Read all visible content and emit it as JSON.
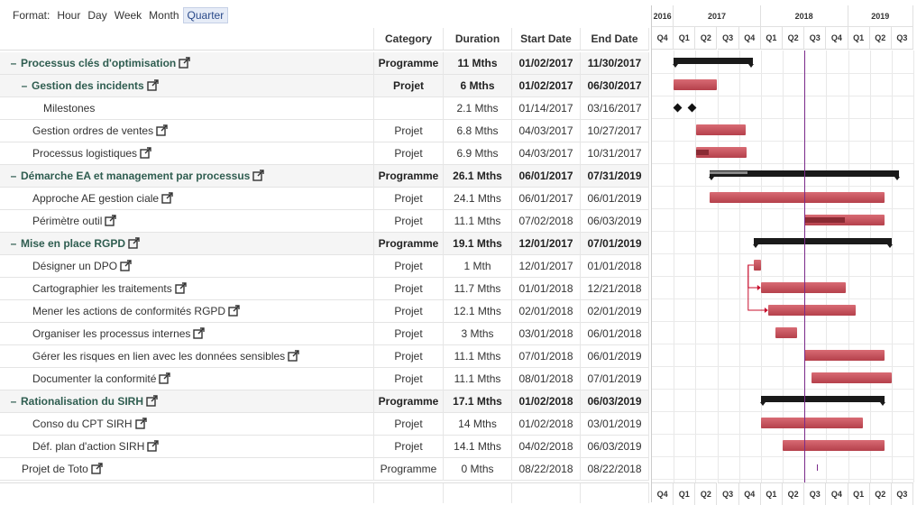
{
  "format_bar": {
    "label": "Format:",
    "options": [
      "Hour",
      "Day",
      "Week",
      "Month",
      "Quarter"
    ],
    "active": "Quarter"
  },
  "columns": {
    "category": "Category",
    "duration": "Duration",
    "start": "Start Date",
    "end": "End Date"
  },
  "rows": [
    {
      "name": "Processus clés d'optimisation",
      "level": 0,
      "group": true,
      "expand": "–",
      "category": "Programme",
      "duration": "11 Mths",
      "start": "01/02/2017",
      "end": "11/30/2017",
      "link": true
    },
    {
      "name": "Gestion des incidents",
      "level": 1,
      "group": true,
      "expand": "–",
      "category": "Projet",
      "duration": "6 Mths",
      "start": "01/02/2017",
      "end": "06/30/2017",
      "link": true
    },
    {
      "name": "Milestones",
      "level": 2,
      "group": false,
      "category": "",
      "duration": "2.1 Mths",
      "start": "01/14/2017",
      "end": "03/16/2017",
      "link": false
    },
    {
      "name": "Gestion ordres de ventes",
      "level": 2,
      "group": false,
      "category": "Projet",
      "duration": "6.8 Mths",
      "start": "04/03/2017",
      "end": "10/27/2017",
      "link": true
    },
    {
      "name": "Processus logistiques",
      "level": 2,
      "group": false,
      "category": "Projet",
      "duration": "6.9 Mths",
      "start": "04/03/2017",
      "end": "10/31/2017",
      "link": true
    },
    {
      "name": "Démarche EA et management par processus",
      "level": 0,
      "group": true,
      "expand": "–",
      "category": "Programme",
      "duration": "26.1 Mths",
      "start": "06/01/2017",
      "end": "07/31/2019",
      "link": true
    },
    {
      "name": "Approche AE gestion ciale",
      "level": 1,
      "group": false,
      "category": "Projet",
      "duration": "24.1 Mths",
      "start": "06/01/2017",
      "end": "06/01/2019",
      "link": true
    },
    {
      "name": "Périmètre outil",
      "level": 1,
      "group": false,
      "category": "Projet",
      "duration": "11.1 Mths",
      "start": "07/02/2018",
      "end": "06/03/2019",
      "link": true
    },
    {
      "name": "Mise en place RGPD",
      "level": 0,
      "group": true,
      "expand": "–",
      "category": "Programme",
      "duration": "19.1 Mths",
      "start": "12/01/2017",
      "end": "07/01/2019",
      "link": true
    },
    {
      "name": "Désigner un DPO",
      "level": 1,
      "group": false,
      "category": "Projet",
      "duration": "1 Mth",
      "start": "12/01/2017",
      "end": "01/01/2018",
      "link": true
    },
    {
      "name": "Cartographier les traitements",
      "level": 1,
      "group": false,
      "category": "Projet",
      "duration": "11.7 Mths",
      "start": "01/01/2018",
      "end": "12/21/2018",
      "link": true
    },
    {
      "name": "Mener les actions de conformités RGPD",
      "level": 1,
      "group": false,
      "category": "Projet",
      "duration": "12.1 Mths",
      "start": "02/01/2018",
      "end": "02/01/2019",
      "link": true
    },
    {
      "name": "Organiser les processus internes",
      "level": 1,
      "group": false,
      "category": "Projet",
      "duration": "3 Mths",
      "start": "03/01/2018",
      "end": "06/01/2018",
      "link": true
    },
    {
      "name": "Gérer les risques en lien avec les données sensibles",
      "level": 1,
      "group": false,
      "category": "Projet",
      "duration": "11.1 Mths",
      "start": "07/01/2018",
      "end": "06/01/2019",
      "link": true
    },
    {
      "name": "Documenter la conformité",
      "level": 1,
      "group": false,
      "category": "Projet",
      "duration": "11.1 Mths",
      "start": "08/01/2018",
      "end": "07/01/2019",
      "link": true
    },
    {
      "name": "Rationalisation du SIRH",
      "level": 0,
      "group": true,
      "expand": "–",
      "category": "Programme",
      "duration": "17.1 Mths",
      "start": "01/02/2018",
      "end": "06/03/2019",
      "link": true
    },
    {
      "name": "Conso du CPT SIRH",
      "level": 1,
      "group": false,
      "category": "Projet",
      "duration": "14 Mths",
      "start": "01/02/2018",
      "end": "03/01/2019",
      "link": true
    },
    {
      "name": "Déf. plan d'action SIRH",
      "level": 1,
      "group": false,
      "category": "Projet",
      "duration": "14.1 Mths",
      "start": "04/02/2018",
      "end": "06/03/2019",
      "link": true
    },
    {
      "name": "Projet de Toto",
      "level": 0,
      "group": false,
      "category": "Programme",
      "duration": "0 Mths",
      "start": "08/22/2018",
      "end": "08/22/2018",
      "link": true
    }
  ],
  "timeline": {
    "years": [
      {
        "label": "2016",
        "quarters": [
          "Q4"
        ]
      },
      {
        "label": "2017",
        "quarters": [
          "Q1",
          "Q2",
          "Q3",
          "Q4"
        ]
      },
      {
        "label": "2018",
        "quarters": [
          "Q1",
          "Q2",
          "Q3",
          "Q4"
        ]
      },
      {
        "label": "2019",
        "quarters": [
          "Q1",
          "Q2",
          "Q3"
        ]
      }
    ],
    "today": "06/30/2018",
    "colors": {
      "task": "#c44a55",
      "task_progress": "#8a2a33",
      "group": "#1a1a1a",
      "today": "#7a2a8a",
      "link_arrow": "#c8102e"
    }
  },
  "gantt": {
    "bars": [
      {
        "row": 0,
        "kind": "group",
        "start": "01/02/2017",
        "end": "11/30/2017",
        "progress": 0
      },
      {
        "row": 1,
        "kind": "task",
        "start": "01/02/2017",
        "end": "06/30/2017",
        "progress": 0
      },
      {
        "row": 2,
        "kind": "milestones",
        "dates": [
          "01/14/2017",
          "03/16/2017"
        ]
      },
      {
        "row": 3,
        "kind": "task",
        "start": "04/03/2017",
        "end": "10/27/2017",
        "progress": 0
      },
      {
        "row": 4,
        "kind": "task",
        "start": "04/03/2017",
        "end": "10/31/2017",
        "progress": 0.25
      },
      {
        "row": 5,
        "kind": "group",
        "start": "06/01/2017",
        "end": "07/31/2019",
        "progress": 0.2
      },
      {
        "row": 6,
        "kind": "task",
        "start": "06/01/2017",
        "end": "06/01/2019",
        "progress": 0
      },
      {
        "row": 7,
        "kind": "task",
        "start": "07/02/2018",
        "end": "06/03/2019",
        "progress": 0.5
      },
      {
        "row": 8,
        "kind": "group",
        "start": "12/01/2017",
        "end": "07/01/2019",
        "progress": 0
      },
      {
        "row": 9,
        "kind": "task",
        "start": "12/01/2017",
        "end": "01/01/2018",
        "progress": 0
      },
      {
        "row": 10,
        "kind": "task",
        "start": "01/01/2018",
        "end": "12/21/2018",
        "progress": 0
      },
      {
        "row": 11,
        "kind": "task",
        "start": "02/01/2018",
        "end": "02/01/2019",
        "progress": 0
      },
      {
        "row": 12,
        "kind": "task",
        "start": "03/01/2018",
        "end": "06/01/2018",
        "progress": 0
      },
      {
        "row": 13,
        "kind": "task",
        "start": "07/01/2018",
        "end": "06/01/2019",
        "progress": 0
      },
      {
        "row": 14,
        "kind": "task",
        "start": "08/01/2018",
        "end": "07/01/2019",
        "progress": 0
      },
      {
        "row": 15,
        "kind": "group",
        "start": "01/02/2018",
        "end": "06/03/2019",
        "progress": 0
      },
      {
        "row": 16,
        "kind": "task",
        "start": "01/02/2018",
        "end": "03/01/2019",
        "progress": 0
      },
      {
        "row": 17,
        "kind": "task",
        "start": "04/02/2018",
        "end": "06/03/2019",
        "progress": 0
      },
      {
        "row": 18,
        "kind": "zero",
        "start": "08/22/2018"
      }
    ],
    "links": [
      {
        "from": 9,
        "to": 10
      },
      {
        "from": 9,
        "to": 11
      }
    ]
  }
}
